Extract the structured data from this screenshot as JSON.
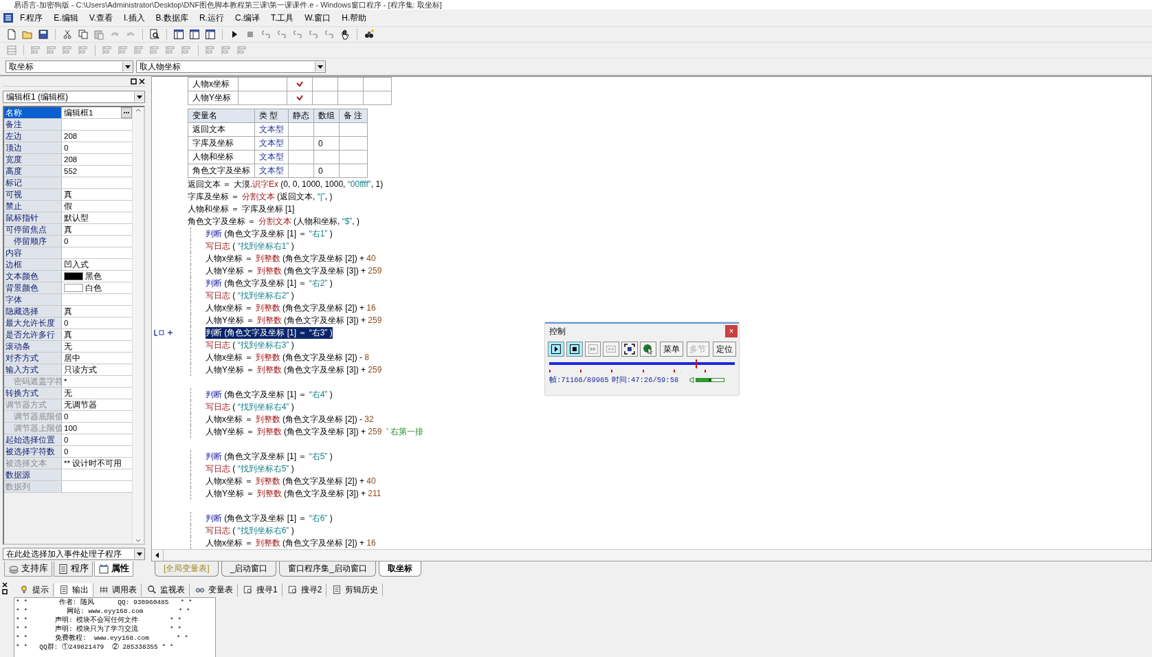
{
  "window": {
    "title": "易语言-加密狗版 - C:\\Users\\Administrator\\Desktop\\DNF图色脚本教程第三课\\第一课课件.e - Windows窗口程序 - [程序集: 取坐标]"
  },
  "menu": [
    "F.程序",
    "E.编辑",
    "V.查看",
    "I.插入",
    "B.数据库",
    "R.运行",
    "C.编译",
    "T.工具",
    "W.窗口",
    "H.帮助"
  ],
  "selectors": {
    "class": "取坐标",
    "method": "取人物坐标"
  },
  "properties": {
    "object": "编辑框1 (编辑框)",
    "rows": [
      {
        "label": "名称",
        "value": "编辑框1",
        "selected": true,
        "disabled": false
      },
      {
        "label": "备注",
        "selected": false,
        "disabled": false
      },
      {
        "label": "左边",
        "value": "208",
        "selected": false,
        "disabled": false
      },
      {
        "label": "顶边",
        "value": "0",
        "selected": false,
        "disabled": false
      },
      {
        "label": "宽度",
        "value": "208",
        "selected": false,
        "disabled": false
      },
      {
        "label": "高度",
        "value": "552",
        "selected": false,
        "disabled": false
      },
      {
        "label": "标记",
        "selected": false,
        "disabled": false
      },
      {
        "label": "可视",
        "value": "真",
        "selected": false,
        "disabled": false
      },
      {
        "label": "禁止",
        "value": "假",
        "selected": false,
        "disabled": false
      },
      {
        "label": "鼠标指针",
        "value": "默认型",
        "selected": false,
        "disabled": false
      },
      {
        "label": "可停留焦点",
        "value": "真",
        "selected": false,
        "disabled": false,
        "children": [
          {
            "label": "停留顺序",
            "value": "0",
            "selected": false,
            "disabled": false
          }
        ]
      },
      {
        "label": "内容",
        "selected": false,
        "disabled": false
      },
      {
        "label": "边框",
        "value": "凹入式",
        "selected": false,
        "disabled": false
      },
      {
        "label": "文本颜色",
        "value": "黑色",
        "color": "#000000",
        "selected": false,
        "disabled": false
      },
      {
        "label": "背景颜色",
        "value": "白色",
        "color": "#ffffff",
        "selected": false,
        "disabled": false
      },
      {
        "label": "字体",
        "selected": false,
        "disabled": false
      },
      {
        "label": "隐藏选择",
        "value": "真",
        "selected": false,
        "disabled": false
      },
      {
        "label": "最大允许长度",
        "value": "0",
        "selected": false,
        "disabled": false
      },
      {
        "label": "是否允许多行",
        "value": "真",
        "selected": false,
        "disabled": false
      },
      {
        "label": "滚动条",
        "value": "无",
        "selected": false,
        "disabled": false
      },
      {
        "label": "对齐方式",
        "value": "居中",
        "selected": false,
        "disabled": false
      },
      {
        "label": "输入方式",
        "value": "只读方式",
        "selected": false,
        "disabled": false,
        "children": [
          {
            "label": "密码遮盖字符",
            "value": "*",
            "selected": false,
            "disabled": true
          }
        ]
      },
      {
        "label": "转换方式",
        "value": "无",
        "selected": false,
        "disabled": false
      },
      {
        "label": "调节器方式",
        "value": "无调节器",
        "selected": false,
        "disabled": true,
        "children": [
          {
            "label": "调节器底限值",
            "value": "0",
            "selected": false,
            "disabled": true
          },
          {
            "label": "调节器上限值",
            "value": "100",
            "selected": false,
            "disabled": true
          }
        ]
      },
      {
        "label": "起始选择位置",
        "value": "0",
        "selected": false,
        "disabled": false
      },
      {
        "label": "被选择字符数",
        "value": "0",
        "selected": false,
        "disabled": false
      },
      {
        "label": "被选择文本",
        "value": "** 设计时不可用",
        "selected": false,
        "disabled": true
      },
      {
        "label": "数据源",
        "selected": false,
        "disabled": false
      },
      {
        "label": "数据列",
        "selected": false,
        "disabled": true
      }
    ],
    "event_selector": "在此处选择加入事件处理子程序"
  },
  "left_tabs": [
    {
      "label": "支持库",
      "kind": "library",
      "selected": false
    },
    {
      "label": "程序",
      "kind": "program",
      "selected": false
    },
    {
      "label": "属性",
      "kind": "property",
      "selected": true
    }
  ],
  "params_table": {
    "rows": [
      {
        "name": "人物x坐标",
        "checked": true
      },
      {
        "name": "人物Y坐标",
        "checked": true
      }
    ]
  },
  "vars_table": {
    "columns": [
      "变量名",
      "类 型",
      "静态",
      "数组",
      "备 注"
    ],
    "rows": [
      {
        "name": "返回文本",
        "type": "文本型",
        "static": false
      },
      {
        "name": "字库及坐标",
        "type": "文本型",
        "static": false,
        "array": "0"
      },
      {
        "name": "人物和坐标",
        "type": "文本型",
        "static": false
      },
      {
        "name": "角色文字及坐标",
        "type": "文本型",
        "static": false,
        "array": "0"
      }
    ]
  },
  "code": [
    {
      "kind": "stmt",
      "tokens": [
        {
          "kind": "plain",
          "text": "返回文本 ＝ 大漠."
        },
        {
          "kind": "fn",
          "text": "识字Ex"
        },
        {
          "kind": "plain",
          "text": " (0, 0, 1000, 1000, "
        },
        {
          "kind": "str",
          "text": "“00ffff”"
        },
        {
          "kind": "plain",
          "text": ", 1)"
        }
      ]
    },
    {
      "kind": "stmt",
      "tokens": [
        {
          "kind": "plain",
          "text": "字库及坐标 ＝ "
        },
        {
          "kind": "fn",
          "text": "分割文本"
        },
        {
          "kind": "plain",
          "text": " (返回文本, "
        },
        {
          "kind": "str",
          "text": "“|”"
        },
        {
          "kind": "plain",
          "text": ", )"
        }
      ]
    },
    {
      "kind": "stmt",
      "tokens": [
        {
          "kind": "plain",
          "text": "人物和坐标 ＝ 字库及坐标 [1]"
        }
      ]
    },
    {
      "kind": "stmt",
      "tokens": [
        {
          "kind": "plain",
          "text": "角色文字及坐标 ＝ "
        },
        {
          "kind": "fn",
          "text": "分割文本"
        },
        {
          "kind": "plain",
          "text": " (人物和坐标, "
        },
        {
          "kind": "str",
          "text": "“$”"
        },
        {
          "kind": "plain",
          "text": ", )"
        }
      ]
    },
    {
      "kind": "judge",
      "selected": false,
      "tokens": [
        {
          "kind": "kw",
          "text": "判断"
        },
        {
          "kind": "plain",
          "text": " (角色文字及坐标 [1] ＝ "
        },
        {
          "kind": "str",
          "text": "“右1”"
        },
        {
          "kind": "plain",
          "text": " )"
        }
      ],
      "children": [
        {
          "kind": "stmt",
          "tokens": [
            {
              "kind": "fn",
              "text": "写日志"
            },
            {
              "kind": "plain",
              "text": " ( "
            },
            {
              "kind": "str",
              "text": "“找到坐标右1”"
            },
            {
              "kind": "plain",
              "text": " )"
            }
          ]
        },
        {
          "kind": "stmt",
          "tokens": [
            {
              "kind": "plain",
              "text": "人物x坐标 ＝ "
            },
            {
              "kind": "fn",
              "text": "到整数"
            },
            {
              "kind": "plain",
              "text": " (角色文字及坐标 [2]) + "
            },
            {
              "kind": "num",
              "text": "40"
            }
          ]
        },
        {
          "kind": "stmt",
          "tokens": [
            {
              "kind": "plain",
              "text": "人物Y坐标 ＝ "
            },
            {
              "kind": "fn",
              "text": "到整数"
            },
            {
              "kind": "plain",
              "text": " (角色文字及坐标 [3]) + "
            },
            {
              "kind": "num",
              "text": "259"
            }
          ]
        }
      ]
    },
    {
      "kind": "judge",
      "selected": false,
      "tokens": [
        {
          "kind": "kw",
          "text": "判断"
        },
        {
          "kind": "plain",
          "text": " (角色文字及坐标 [1] ＝ "
        },
        {
          "kind": "str",
          "text": "“右2”"
        },
        {
          "kind": "plain",
          "text": " )"
        }
      ],
      "children": [
        {
          "kind": "stmt",
          "tokens": [
            {
              "kind": "fn",
              "text": "写日志"
            },
            {
              "kind": "plain",
              "text": " ( "
            },
            {
              "kind": "str",
              "text": "“找到坐标右2”"
            },
            {
              "kind": "plain",
              "text": " )"
            }
          ]
        },
        {
          "kind": "stmt",
          "tokens": [
            {
              "kind": "plain",
              "text": "人物x坐标 ＝ "
            },
            {
              "kind": "fn",
              "text": "到整数"
            },
            {
              "kind": "plain",
              "text": " (角色文字及坐标 [2]) + "
            },
            {
              "kind": "num",
              "text": "16"
            }
          ]
        },
        {
          "kind": "stmt",
          "tokens": [
            {
              "kind": "plain",
              "text": "人物Y坐标 ＝ "
            },
            {
              "kind": "fn",
              "text": "到整数"
            },
            {
              "kind": "plain",
              "text": " (角色文字及坐标 [3]) + "
            },
            {
              "kind": "num",
              "text": "259"
            }
          ]
        }
      ]
    },
    {
      "kind": "judge",
      "selected": true,
      "tokens": [
        {
          "kind": "kw",
          "text": "判断"
        },
        {
          "kind": "plain",
          "text": " (角色文字及坐标 [1] ＝ "
        },
        {
          "kind": "str",
          "text": "“右3”"
        },
        {
          "kind": "plain",
          "text": " )"
        }
      ],
      "children": [
        {
          "kind": "stmt",
          "tokens": [
            {
              "kind": "fn",
              "text": "写日志"
            },
            {
              "kind": "plain",
              "text": " ( "
            },
            {
              "kind": "str",
              "text": "“找到坐标右3”"
            },
            {
              "kind": "plain",
              "text": " )"
            }
          ]
        },
        {
          "kind": "stmt",
          "tokens": [
            {
              "kind": "plain",
              "text": "人物x坐标 ＝ "
            },
            {
              "kind": "fn",
              "text": "到整数"
            },
            {
              "kind": "plain",
              "text": " (角色文字及坐标 [2]) - "
            },
            {
              "kind": "num",
              "text": "8"
            }
          ]
        },
        {
          "kind": "stmt",
          "tokens": [
            {
              "kind": "plain",
              "text": "人物Y坐标 ＝ "
            },
            {
              "kind": "fn",
              "text": "到整数"
            },
            {
              "kind": "plain",
              "text": " (角色文字及坐标 [3]) + "
            },
            {
              "kind": "num",
              "text": "259"
            }
          ]
        }
      ]
    },
    {
      "kind": "blank"
    },
    {
      "kind": "judge",
      "selected": false,
      "tokens": [
        {
          "kind": "kw",
          "text": "判断"
        },
        {
          "kind": "plain",
          "text": " (角色文字及坐标 [1] ＝ "
        },
        {
          "kind": "str",
          "text": "“右4”"
        },
        {
          "kind": "plain",
          "text": " )"
        }
      ],
      "children": [
        {
          "kind": "stmt",
          "tokens": [
            {
              "kind": "fn",
              "text": "写日志"
            },
            {
              "kind": "plain",
              "text": " ( "
            },
            {
              "kind": "str",
              "text": "“找到坐标右4”"
            },
            {
              "kind": "plain",
              "text": " )"
            }
          ]
        },
        {
          "kind": "stmt",
          "tokens": [
            {
              "kind": "plain",
              "text": "人物x坐标 ＝ "
            },
            {
              "kind": "fn",
              "text": "到整数"
            },
            {
              "kind": "plain",
              "text": " (角色文字及坐标 [2]) - "
            },
            {
              "kind": "num",
              "text": "32"
            }
          ]
        },
        {
          "kind": "stmt",
          "tokens": [
            {
              "kind": "plain",
              "text": "人物Y坐标 ＝ "
            },
            {
              "kind": "fn",
              "text": "到整数"
            },
            {
              "kind": "plain",
              "text": " (角色文字及坐标 [3]) + "
            },
            {
              "kind": "num",
              "text": "259"
            },
            {
              "kind": "cmt",
              "text": "  ’ 右第一排"
            }
          ]
        }
      ]
    },
    {
      "kind": "blank"
    },
    {
      "kind": "judge",
      "selected": false,
      "tokens": [
        {
          "kind": "kw",
          "text": "判断"
        },
        {
          "kind": "plain",
          "text": " (角色文字及坐标 [1] ＝ "
        },
        {
          "kind": "str",
          "text": "“右5”"
        },
        {
          "kind": "plain",
          "text": " )"
        }
      ],
      "children": [
        {
          "kind": "stmt",
          "tokens": [
            {
              "kind": "fn",
              "text": "写日志"
            },
            {
              "kind": "plain",
              "text": " ( "
            },
            {
              "kind": "str",
              "text": "“找到坐标右5”"
            },
            {
              "kind": "plain",
              "text": " )"
            }
          ]
        },
        {
          "kind": "stmt",
          "tokens": [
            {
              "kind": "plain",
              "text": "人物x坐标 ＝ "
            },
            {
              "kind": "fn",
              "text": "到整数"
            },
            {
              "kind": "plain",
              "text": " (角色文字及坐标 [2]) + "
            },
            {
              "kind": "num",
              "text": "40"
            }
          ]
        },
        {
          "kind": "stmt",
          "tokens": [
            {
              "kind": "plain",
              "text": "人物Y坐标 ＝ "
            },
            {
              "kind": "fn",
              "text": "到整数"
            },
            {
              "kind": "plain",
              "text": " (角色文字及坐标 [3]) + "
            },
            {
              "kind": "num",
              "text": "211"
            }
          ]
        }
      ]
    },
    {
      "kind": "blank"
    },
    {
      "kind": "judge",
      "selected": false,
      "tokens": [
        {
          "kind": "kw",
          "text": "判断"
        },
        {
          "kind": "plain",
          "text": " (角色文字及坐标 [1] ＝ "
        },
        {
          "kind": "str",
          "text": "“右6”"
        },
        {
          "kind": "plain",
          "text": " )"
        }
      ],
      "children": [
        {
          "kind": "stmt",
          "tokens": [
            {
              "kind": "fn",
              "text": "写日志"
            },
            {
              "kind": "plain",
              "text": " ( "
            },
            {
              "kind": "str",
              "text": "“找到坐标右6”"
            },
            {
              "kind": "plain",
              "text": " )"
            }
          ]
        },
        {
          "kind": "stmt",
          "tokens": [
            {
              "kind": "plain",
              "text": "人物x坐标 ＝ "
            },
            {
              "kind": "fn",
              "text": "到整数"
            },
            {
              "kind": "plain",
              "text": " (角色文字及坐标 [2]) + "
            },
            {
              "kind": "num",
              "text": "16"
            }
          ]
        }
      ]
    }
  ],
  "doc_tabs": [
    {
      "label": "[全局变量表]",
      "kind": "global",
      "selected": false
    },
    {
      "label": "_启动窗口",
      "kind": "window",
      "selected": false
    },
    {
      "label": "窗口程序集_启动窗口",
      "kind": "module",
      "selected": false
    },
    {
      "label": "取坐标",
      "kind": "module",
      "selected": true
    }
  ],
  "bottom_tabs": [
    {
      "label": "提示",
      "kind": "hint",
      "selected": false
    },
    {
      "label": "输出",
      "kind": "output",
      "selected": true
    },
    {
      "label": "调用表",
      "kind": "calls",
      "selected": false
    },
    {
      "label": "监视表",
      "kind": "watch",
      "selected": false
    },
    {
      "label": "变量表",
      "kind": "vars",
      "selected": false
    },
    {
      "label": "搜寻1",
      "kind": "search",
      "selected": false
    },
    {
      "label": "搜寻2",
      "kind": "search",
      "selected": false
    },
    {
      "label": "剪辑历史",
      "kind": "clip",
      "selected": false
    }
  ],
  "output": [
    "* *        作者: 随风      QQ: 930960485   * *",
    "* *          网站: www.eyy168.com         * *",
    "* *       声明: 模块不会写任何文件        * *",
    "* *       声明: 模块只为了学习交流        * *",
    "* *       免费教程:  www.eyy168.com       * *",
    "* *   QQ群: ①249821479  ② 285338355 * *"
  ],
  "control": {
    "title": "控制",
    "close": "×",
    "tool_buttons": [
      {
        "kind": "play",
        "disabled": false
      },
      {
        "kind": "stop",
        "disabled": false
      },
      {
        "kind": "skip",
        "disabled": true
      },
      {
        "kind": "fit",
        "disabled": true
      },
      {
        "kind": "fullscreen",
        "disabled": false
      },
      {
        "kind": "pointer",
        "disabled": false
      }
    ],
    "buttons": [
      {
        "label": "菜单",
        "disabled": false
      },
      {
        "label": "多节",
        "disabled": true
      },
      {
        "label": "定位",
        "disabled": false
      }
    ],
    "position": {
      "level": 0.79
    },
    "frame": "帧:71166/89965",
    "time": "时间:47:26/59:58",
    "volume": {
      "level": 0.55
    }
  }
}
